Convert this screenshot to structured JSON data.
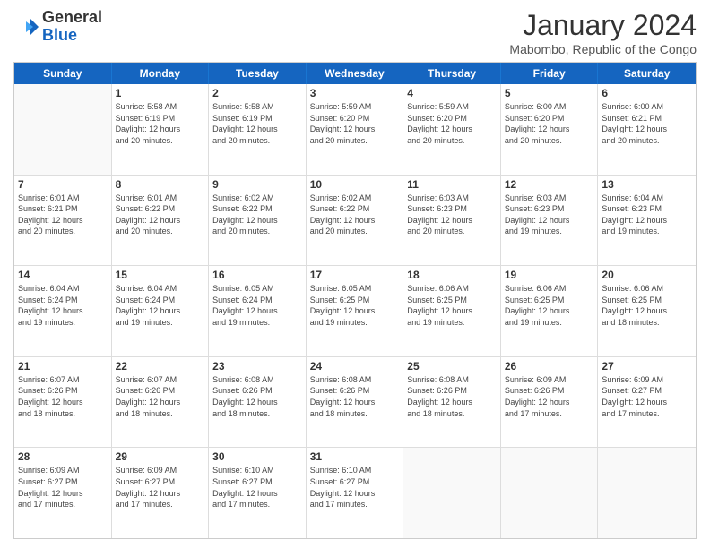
{
  "logo": {
    "general": "General",
    "blue": "Blue"
  },
  "header": {
    "month": "January 2024",
    "location": "Mabombo, Republic of the Congo"
  },
  "weekdays": [
    "Sunday",
    "Monday",
    "Tuesday",
    "Wednesday",
    "Thursday",
    "Friday",
    "Saturday"
  ],
  "rows": [
    [
      {
        "day": "",
        "empty": true
      },
      {
        "day": "1",
        "sunrise": "5:58 AM",
        "sunset": "6:19 PM",
        "daylight": "12 hours and 20 minutes."
      },
      {
        "day": "2",
        "sunrise": "5:58 AM",
        "sunset": "6:19 PM",
        "daylight": "12 hours and 20 minutes."
      },
      {
        "day": "3",
        "sunrise": "5:59 AM",
        "sunset": "6:20 PM",
        "daylight": "12 hours and 20 minutes."
      },
      {
        "day": "4",
        "sunrise": "5:59 AM",
        "sunset": "6:20 PM",
        "daylight": "12 hours and 20 minutes."
      },
      {
        "day": "5",
        "sunrise": "6:00 AM",
        "sunset": "6:20 PM",
        "daylight": "12 hours and 20 minutes."
      },
      {
        "day": "6",
        "sunrise": "6:00 AM",
        "sunset": "6:21 PM",
        "daylight": "12 hours and 20 minutes."
      }
    ],
    [
      {
        "day": "7",
        "sunrise": "6:01 AM",
        "sunset": "6:21 PM",
        "daylight": "12 hours and 20 minutes."
      },
      {
        "day": "8",
        "sunrise": "6:01 AM",
        "sunset": "6:22 PM",
        "daylight": "12 hours and 20 minutes."
      },
      {
        "day": "9",
        "sunrise": "6:02 AM",
        "sunset": "6:22 PM",
        "daylight": "12 hours and 20 minutes."
      },
      {
        "day": "10",
        "sunrise": "6:02 AM",
        "sunset": "6:22 PM",
        "daylight": "12 hours and 20 minutes."
      },
      {
        "day": "11",
        "sunrise": "6:03 AM",
        "sunset": "6:23 PM",
        "daylight": "12 hours and 20 minutes."
      },
      {
        "day": "12",
        "sunrise": "6:03 AM",
        "sunset": "6:23 PM",
        "daylight": "12 hours and 19 minutes."
      },
      {
        "day": "13",
        "sunrise": "6:04 AM",
        "sunset": "6:23 PM",
        "daylight": "12 hours and 19 minutes."
      }
    ],
    [
      {
        "day": "14",
        "sunrise": "6:04 AM",
        "sunset": "6:24 PM",
        "daylight": "12 hours and 19 minutes."
      },
      {
        "day": "15",
        "sunrise": "6:04 AM",
        "sunset": "6:24 PM",
        "daylight": "12 hours and 19 minutes."
      },
      {
        "day": "16",
        "sunrise": "6:05 AM",
        "sunset": "6:24 PM",
        "daylight": "12 hours and 19 minutes."
      },
      {
        "day": "17",
        "sunrise": "6:05 AM",
        "sunset": "6:25 PM",
        "daylight": "12 hours and 19 minutes."
      },
      {
        "day": "18",
        "sunrise": "6:06 AM",
        "sunset": "6:25 PM",
        "daylight": "12 hours and 19 minutes."
      },
      {
        "day": "19",
        "sunrise": "6:06 AM",
        "sunset": "6:25 PM",
        "daylight": "12 hours and 19 minutes."
      },
      {
        "day": "20",
        "sunrise": "6:06 AM",
        "sunset": "6:25 PM",
        "daylight": "12 hours and 18 minutes."
      }
    ],
    [
      {
        "day": "21",
        "sunrise": "6:07 AM",
        "sunset": "6:26 PM",
        "daylight": "12 hours and 18 minutes."
      },
      {
        "day": "22",
        "sunrise": "6:07 AM",
        "sunset": "6:26 PM",
        "daylight": "12 hours and 18 minutes."
      },
      {
        "day": "23",
        "sunrise": "6:08 AM",
        "sunset": "6:26 PM",
        "daylight": "12 hours and 18 minutes."
      },
      {
        "day": "24",
        "sunrise": "6:08 AM",
        "sunset": "6:26 PM",
        "daylight": "12 hours and 18 minutes."
      },
      {
        "day": "25",
        "sunrise": "6:08 AM",
        "sunset": "6:26 PM",
        "daylight": "12 hours and 18 minutes."
      },
      {
        "day": "26",
        "sunrise": "6:09 AM",
        "sunset": "6:26 PM",
        "daylight": "12 hours and 17 minutes."
      },
      {
        "day": "27",
        "sunrise": "6:09 AM",
        "sunset": "6:27 PM",
        "daylight": "12 hours and 17 minutes."
      }
    ],
    [
      {
        "day": "28",
        "sunrise": "6:09 AM",
        "sunset": "6:27 PM",
        "daylight": "12 hours and 17 minutes."
      },
      {
        "day": "29",
        "sunrise": "6:09 AM",
        "sunset": "6:27 PM",
        "daylight": "12 hours and 17 minutes."
      },
      {
        "day": "30",
        "sunrise": "6:10 AM",
        "sunset": "6:27 PM",
        "daylight": "12 hours and 17 minutes."
      },
      {
        "day": "31",
        "sunrise": "6:10 AM",
        "sunset": "6:27 PM",
        "daylight": "12 hours and 17 minutes."
      },
      {
        "day": "",
        "empty": true
      },
      {
        "day": "",
        "empty": true
      },
      {
        "day": "",
        "empty": true
      }
    ]
  ],
  "labels": {
    "sunrise_prefix": "Sunrise: ",
    "sunset_prefix": "Sunset: ",
    "daylight_prefix": "Daylight: "
  }
}
